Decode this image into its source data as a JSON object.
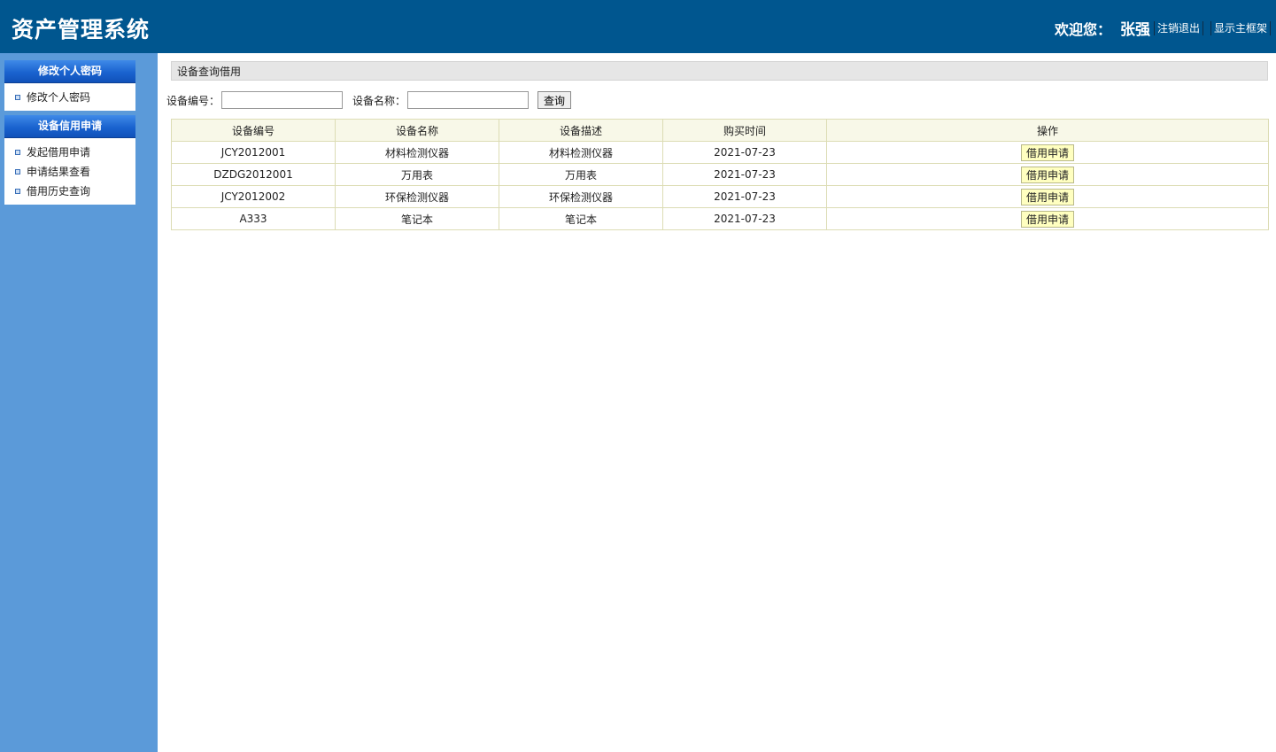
{
  "header": {
    "title": "资产管理系统",
    "welcome": "欢迎您：",
    "user": "张强",
    "logout": "注销退出",
    "show_frame": "显示主框架"
  },
  "sidebar": {
    "groups": [
      {
        "title": "修改个人密码",
        "items": [
          "修改个人密码"
        ]
      },
      {
        "title": "设备信用申请",
        "items": [
          "发起借用申请",
          "申请结果查看",
          "借用历史查询"
        ]
      }
    ]
  },
  "main": {
    "section_title": "设备查询借用",
    "search": {
      "code_label": "设备编号：",
      "code_value": "",
      "name_label": "设备名称：",
      "name_value": "",
      "button": "查询"
    },
    "table": {
      "columns": [
        "设备编号",
        "设备名称",
        "设备描述",
        "购买时间",
        "操作"
      ],
      "rows": [
        {
          "code": "JCY2012001",
          "name": "材料检测仪器",
          "desc": "材料检测仪器",
          "date": "2021-07-23",
          "action": "借用申请"
        },
        {
          "code": "DZDG2012001",
          "name": "万用表",
          "desc": "万用表",
          "date": "2021-07-23",
          "action": "借用申请"
        },
        {
          "code": "JCY2012002",
          "name": "环保检测仪器",
          "desc": "环保检测仪器",
          "date": "2021-07-23",
          "action": "借用申请"
        },
        {
          "code": "A333",
          "name": "笔记本",
          "desc": "笔记本",
          "date": "2021-07-23",
          "action": "借用申请"
        }
      ]
    }
  },
  "colors": {
    "header_bg": "#00568f",
    "sidebar_bg": "#5b9ad9",
    "menu_header": "#1a63cf",
    "table_header_bg": "#f8f8e8",
    "action_button_bg": "#ffffc0"
  }
}
